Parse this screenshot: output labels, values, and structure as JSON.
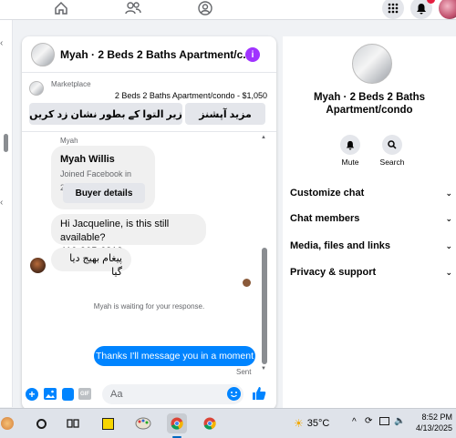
{
  "header": {
    "title": "Myah · 2 Beds 2 Baths Apartment/c...",
    "info_icon": "i"
  },
  "marketplace": {
    "label": "Marketplace",
    "listing": "2 Beds 2 Baths Apartment/condo - $1,050",
    "btn_more": "مزید آپشنز",
    "btn_pending": "زیر التوا کے بطور نشان زد کریں"
  },
  "thread": {
    "sender_label": "Myah",
    "card_name": "Myah Willis",
    "card_joined": "Joined Facebook in 2018",
    "card_button": "Buyer details",
    "msg1_line1": "Hi Jacqueline, is this still available?",
    "msg1_line2": "410-905-6819",
    "msg2": "پیغام بھیج دیا گیا",
    "waiting": "Myah is waiting for your response.",
    "my_msg": "Thanks I'll message you in a moment",
    "status": "Sent"
  },
  "composer": {
    "placeholder": "Aa"
  },
  "right": {
    "name_line1": "Myah · 2 Beds 2 Baths",
    "name_line2": "Apartment/condo",
    "mute": "Mute",
    "search": "Search",
    "menu": [
      "Customize chat",
      "Chat members",
      "Media, files and links",
      "Privacy & support"
    ]
  },
  "taskbar": {
    "weather": "35°C",
    "time": "8:52 PM",
    "date": "4/13/2025"
  },
  "colors": {
    "brand": "#0084ff",
    "purple": "#a033ff"
  }
}
